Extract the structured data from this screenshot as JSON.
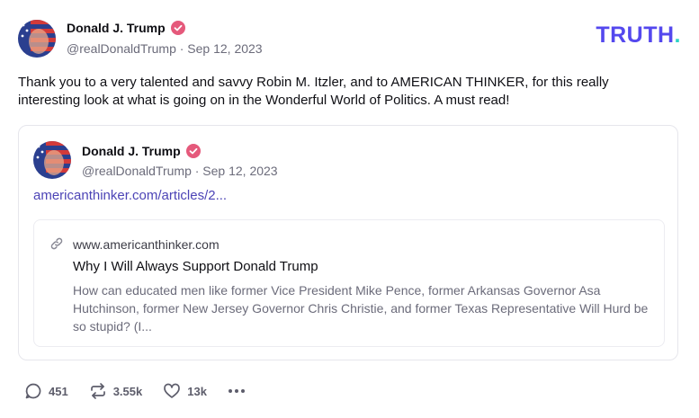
{
  "post": {
    "author": {
      "display_name": "Donald J. Trump",
      "handle_date": "@realDonaldTrump · Sep 12, 2023",
      "verified_icon": "verified-badge-icon"
    },
    "brand": {
      "logo_text": "TRUTH",
      "logo_dot": ".",
      "logo_color": "#5448ee",
      "dot_color": "#2ed3c6"
    },
    "text": "Thank you to a very talented and savvy Robin M. Itzler, and to AMERICAN THINKER, for this really interesting look at what is going on in the Wonderful World of Politics. A must read!",
    "quoted": {
      "display_name": "Donald J. Trump",
      "handle_date": "@realDonaldTrump · Sep 12, 2023",
      "link_text": "americanthinker.com/articles/2...",
      "card": {
        "domain": "www.americanthinker.com",
        "title": "Why I Will Always Support Donald Trump",
        "description": "How can educated men like former Vice President Mike Pence, former Arkansas Governor Asa Hutchinson, former New Jersey Governor Chris Christie, and former Texas Representative Will Hurd be so stupid? (I..."
      }
    },
    "actions": {
      "replies": "451",
      "retruths": "3.55k",
      "likes": "13k"
    }
  }
}
